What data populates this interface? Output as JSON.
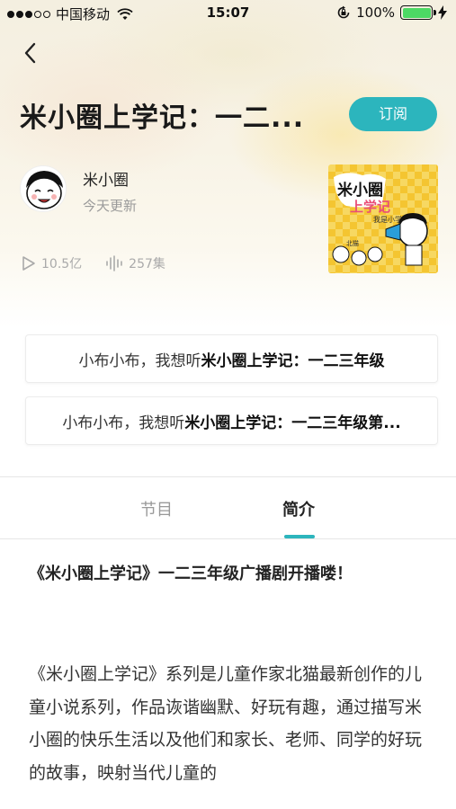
{
  "status_bar": {
    "carrier": "中国移动",
    "time": "15:07",
    "battery": "100%",
    "battery_level": 1.0,
    "signal_bars": 3
  },
  "header": {
    "title": "米小圈上学记：一二...",
    "subscribe_label": "订阅"
  },
  "author": {
    "name": "米小圈",
    "update": "今天更新"
  },
  "stats": {
    "plays": "10.5亿",
    "episodes": "257集"
  },
  "voice_suggestions": [
    {
      "prefix": "小布小布，我想听 ",
      "title": "米小圈上学记：一二三年级"
    },
    {
      "prefix": "小布小布，我想听 ",
      "title": "米小圈上学记：一二三年级第..."
    }
  ],
  "tabs": [
    {
      "label": "节目",
      "active": false
    },
    {
      "label": "简介",
      "active": true
    }
  ],
  "description": {
    "headline": "《米小圈上学记》一二三年级广播剧开播喽！",
    "body": "《米小圈上学记》系列是儿童作家北猫最新创作的儿童小说系列，作品诙谐幽默、好玩有趣，通过描写米小圈的快乐生活以及他们和家长、老师、同学的好玩的故事，映射当代儿童的"
  },
  "colors": {
    "accent": "#2cb5bd",
    "battery": "#4cd964"
  }
}
